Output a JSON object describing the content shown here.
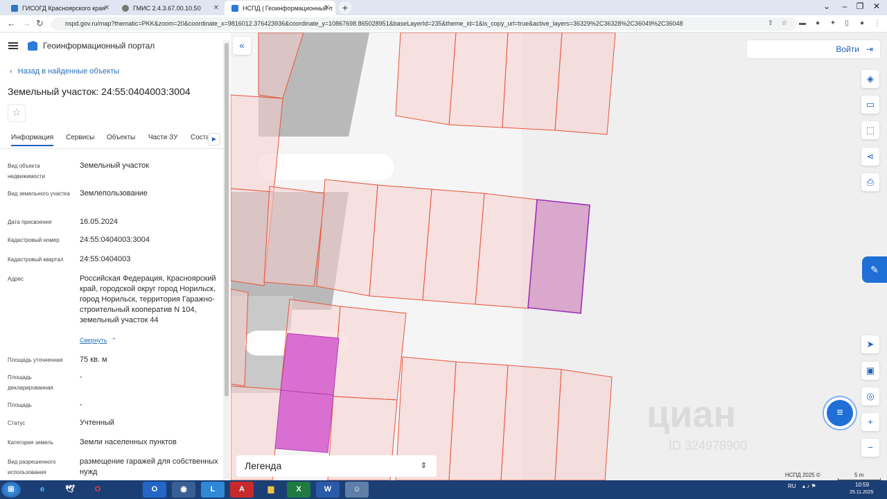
{
  "browser": {
    "tabs": [
      {
        "title": "ГИСОГД Красноярского края",
        "active": false
      },
      {
        "title": "ГМИС 2.4.3.67.00.10.50",
        "active": false
      },
      {
        "title": "НСПД | Геоинформационный п",
        "active": true
      }
    ],
    "new_tab": "+",
    "url": "nspd.gov.ru/map?thematic=PKK&zoom=20&coordinate_x=9816012.376423936&coordinate_y=10867698.865028951&baseLayerId=235&theme_id=1&is_copy_url=true&active_layers=36329%2C36328%2C36049%2C36048"
  },
  "portal": {
    "brand": "Геоинформационный портал",
    "back_link": "Назад в найденные объекты",
    "title": "Земельный участок: 24:55:0404003:3004",
    "tabs": [
      "Информация",
      "Сервисы",
      "Объекты",
      "Части ЗУ",
      "Соста"
    ],
    "fields": [
      {
        "label": "Вид объекта недвижимости",
        "value": "Земельный участок"
      },
      {
        "label": "Вид земельного участка",
        "value": "Землепользование"
      },
      {
        "label": "Дата присвоения",
        "value": "16.05.2024"
      },
      {
        "label": "Кадастровый номер",
        "value": "24:55:0404003:3004"
      },
      {
        "label": "Кадастровый квартал",
        "value": "24:55:0404003"
      },
      {
        "label": "Адрес",
        "value": "Российская Федерация, Красноярский край, городской округ город Норильск, город Норильск, территория Гаражно-строительный кооператив N 104, земельный участок 44"
      },
      {
        "label": "Площадь уточненная",
        "value": "75 кв. м"
      },
      {
        "label": "Площадь декларированная",
        "value": "-"
      },
      {
        "label": "Площадь",
        "value": "-"
      },
      {
        "label": "Статус",
        "value": "Учтенный"
      },
      {
        "label": "Категория земель",
        "value": "Земли населенных пунктов"
      },
      {
        "label": "Вид разрешенного использования",
        "value": "размещение гаражей для собственных нужд"
      }
    ],
    "collapse_label": "Свернуть"
  },
  "map": {
    "login_label": "Войти",
    "legend_label": "Легенда",
    "watermark": "циан",
    "watermark_sub": "ID 324978900",
    "scale_label": "5 m",
    "copyright": "НСПД 2025 ©"
  },
  "taskbar": {
    "lang": "RU",
    "time": "10:59",
    "date": "25.11.2025"
  },
  "colors": {
    "accent": "#1f5fbf",
    "parcel_fill": "#f6dcdc",
    "parcel_stroke": "#e8553a",
    "selected_fill": "#d9a8cc",
    "selected_stroke": "#9b2fb5",
    "highlight_fill": "#d96fd0"
  }
}
